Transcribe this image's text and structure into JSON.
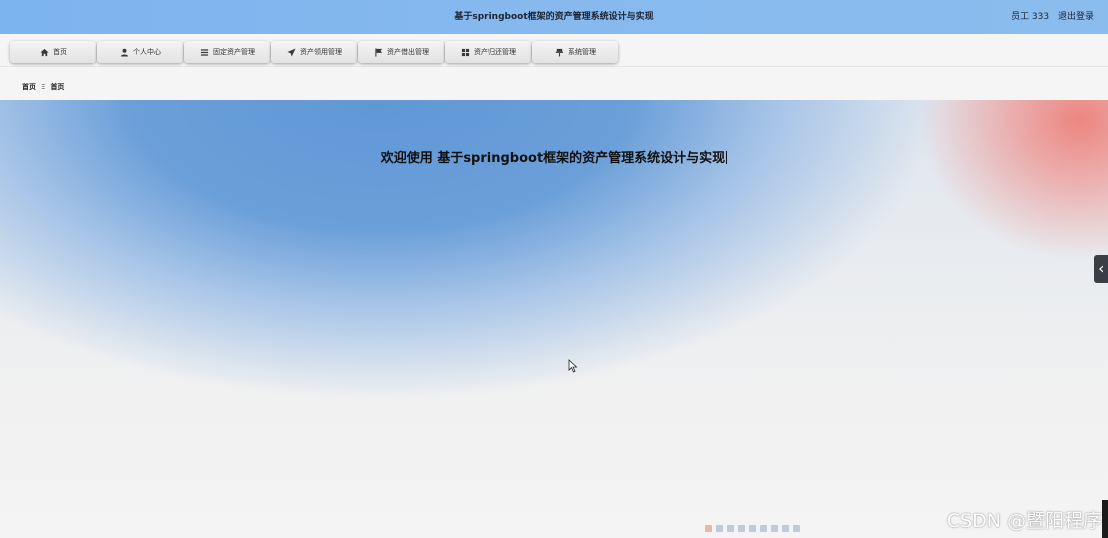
{
  "header": {
    "title": "基于springboot框架的资产管理系统设计与实现",
    "user_label": "员工 333",
    "logout_label": "退出登录"
  },
  "nav": {
    "items": [
      {
        "label": "首页",
        "icon": "home-icon"
      },
      {
        "label": "个人中心",
        "icon": "user-icon"
      },
      {
        "label": "固定资产管理",
        "icon": "list-icon"
      },
      {
        "label": "资产领用管理",
        "icon": "send-icon"
      },
      {
        "label": "资产借出管理",
        "icon": "flag-icon"
      },
      {
        "label": "资产归还管理",
        "icon": "grid-icon"
      },
      {
        "label": "系统管理",
        "icon": "pin-icon"
      }
    ]
  },
  "breadcrumb": {
    "root": "首页",
    "separator": "Ξ",
    "current": "首页"
  },
  "hero": {
    "welcome_text": "欢迎使用 基于springboot框架的资产管理系统设计与实现"
  },
  "watermark": "CSDN @暨阳程序",
  "colors": {
    "header_bg": "#7cb4ef",
    "nav_bg": "#e3e3e3",
    "hero_blue": "#5f97d6",
    "hero_red": "#ee807a"
  }
}
